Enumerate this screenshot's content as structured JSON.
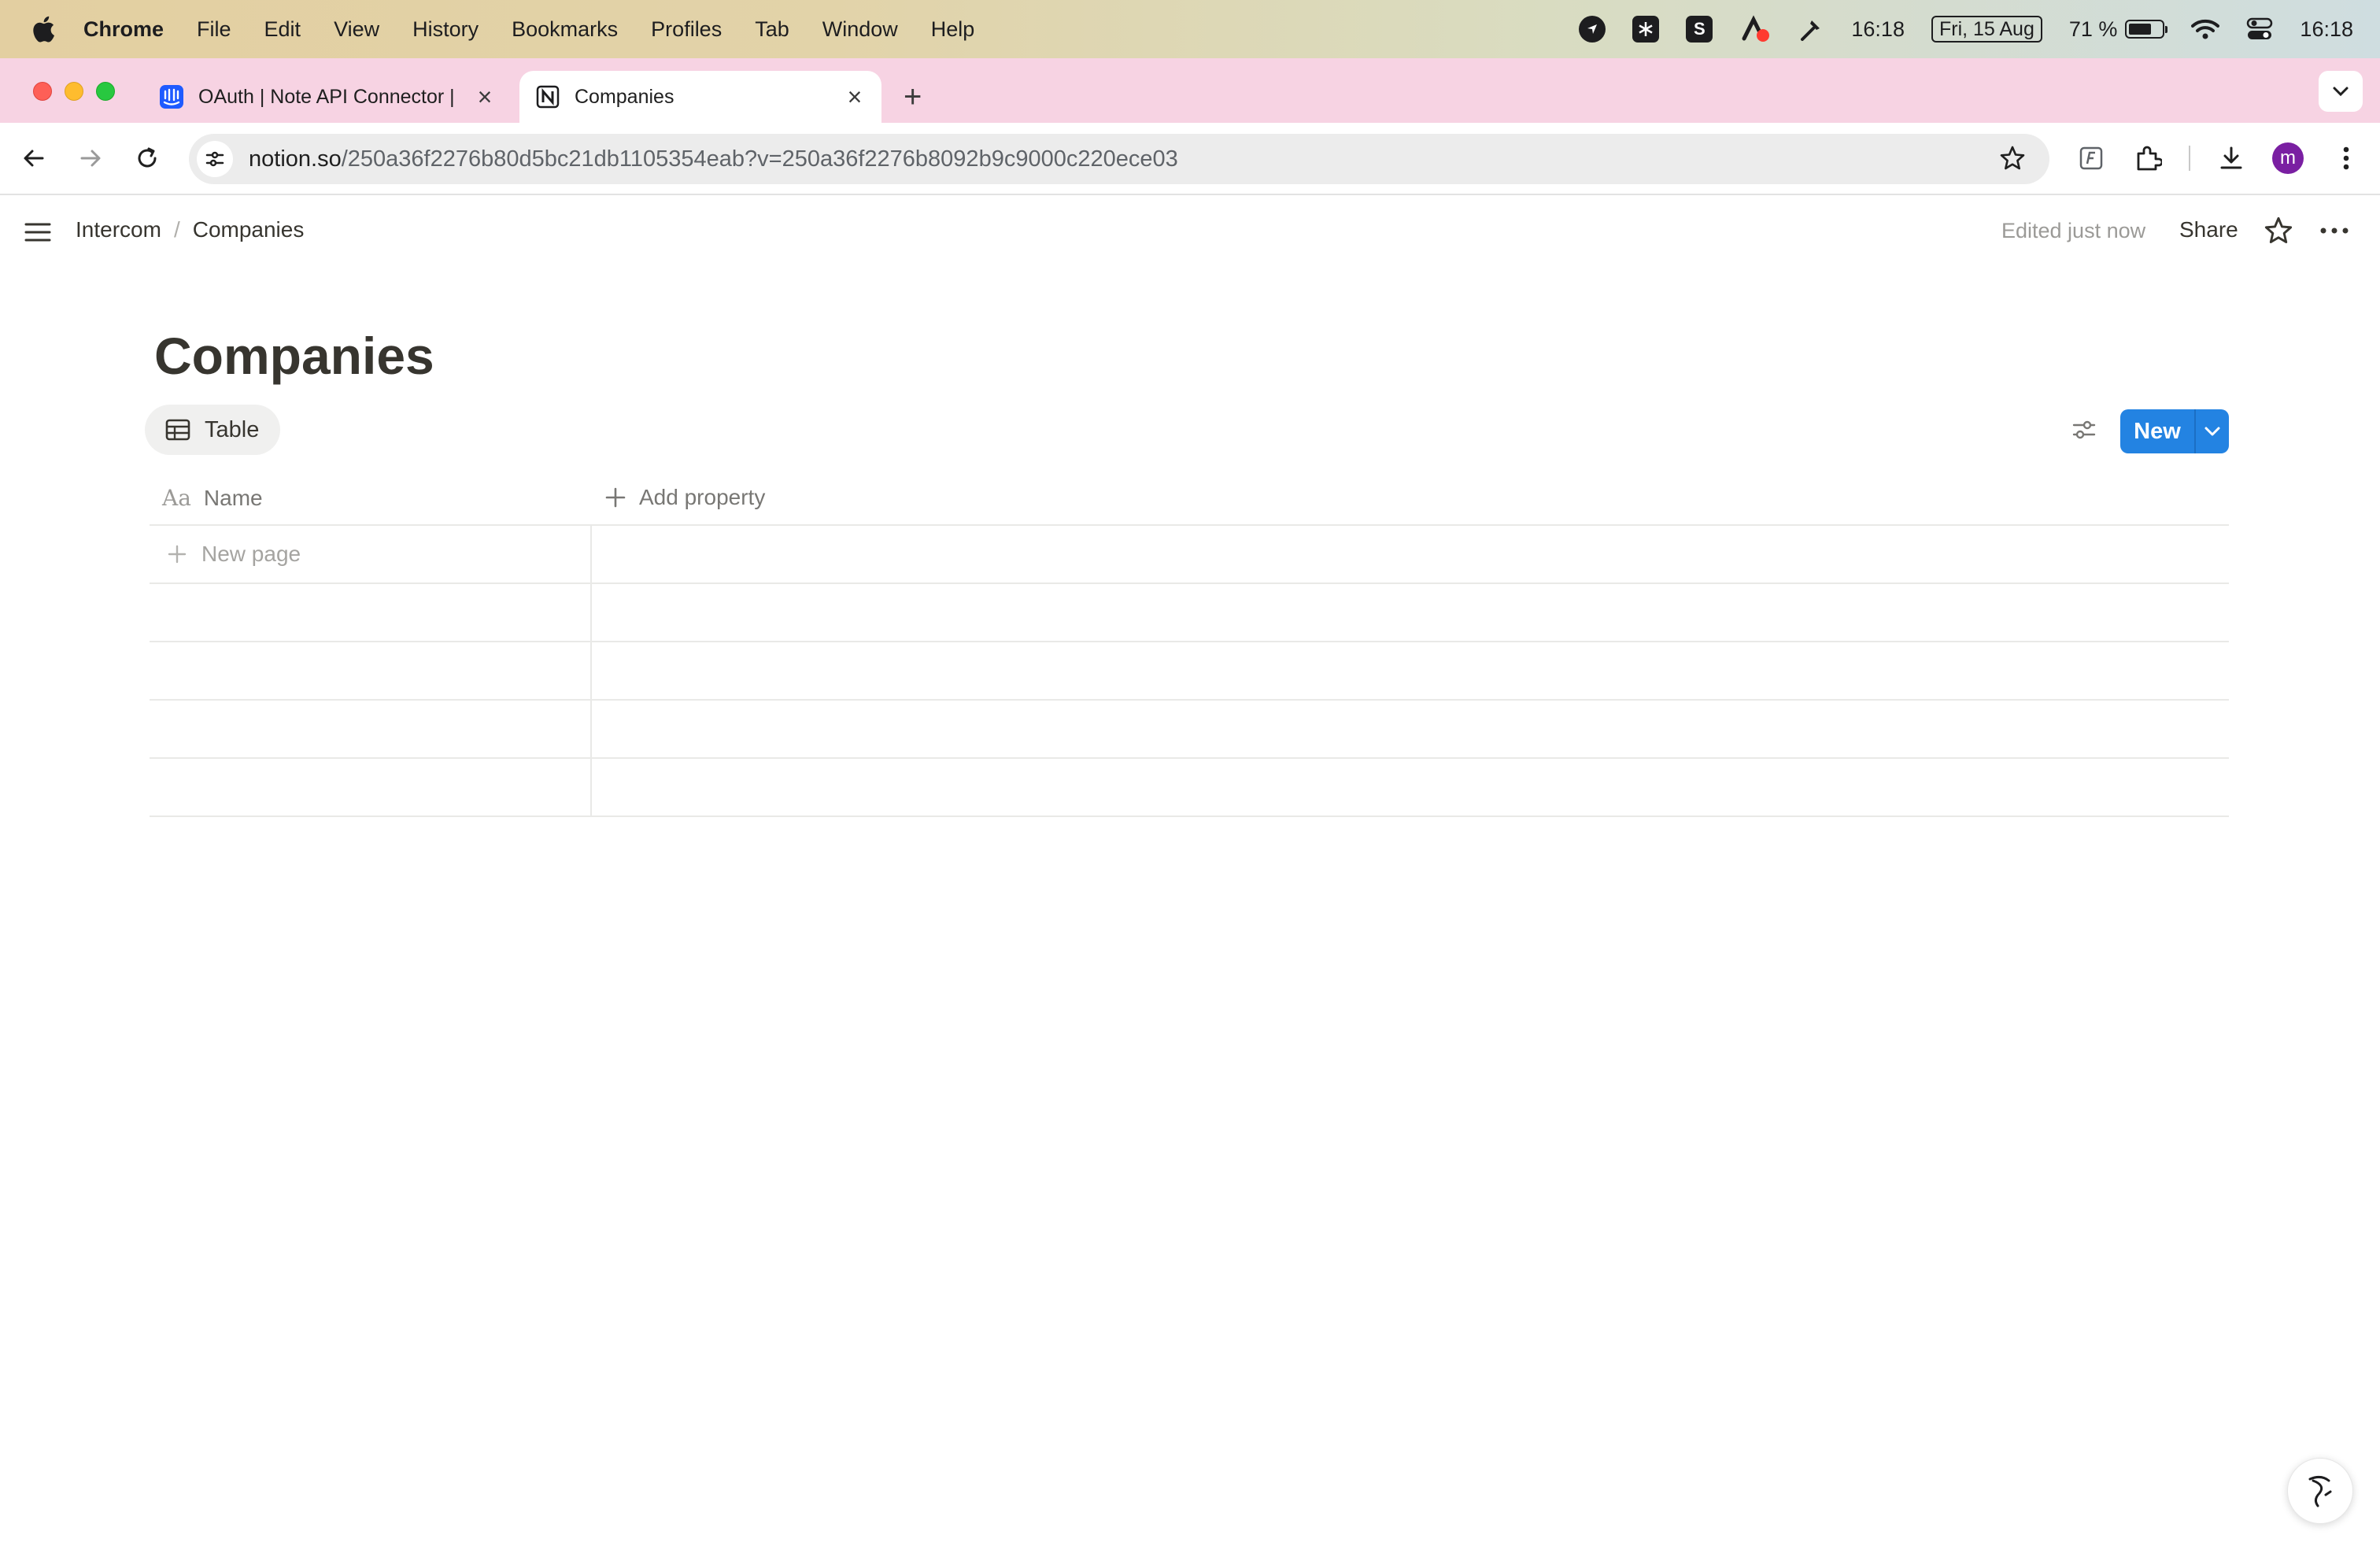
{
  "menubar": {
    "app": "Chrome",
    "items": [
      "File",
      "Edit",
      "View",
      "History",
      "Bookmarks",
      "Profiles",
      "Tab",
      "Window",
      "Help"
    ],
    "status": {
      "s_badge": "S",
      "clock1": "16:18",
      "date": "Fri, 15 Aug",
      "battery": "71 %",
      "battery_level": 0.71,
      "clock2": "16:18"
    }
  },
  "tabs": [
    {
      "title": "OAuth | Note API Connector |",
      "active": false
    },
    {
      "title": "Companies",
      "active": true
    }
  ],
  "toolbar": {
    "url_host": "notion.so",
    "url_path": "/250a36f2276b80d5bc21db1105354eab?v=250a36f2276b8092b9c9000c220ece03",
    "avatar_letter": "m"
  },
  "notion": {
    "breadcrumb": [
      "Intercom",
      "Companies"
    ],
    "edited": "Edited just now",
    "share": "Share",
    "page_title": "Companies",
    "view_tab": "Table",
    "new_button": "New",
    "columns": {
      "name": "Name",
      "add_property": "Add property"
    },
    "new_page": "New page",
    "accent": "#2383e2"
  }
}
